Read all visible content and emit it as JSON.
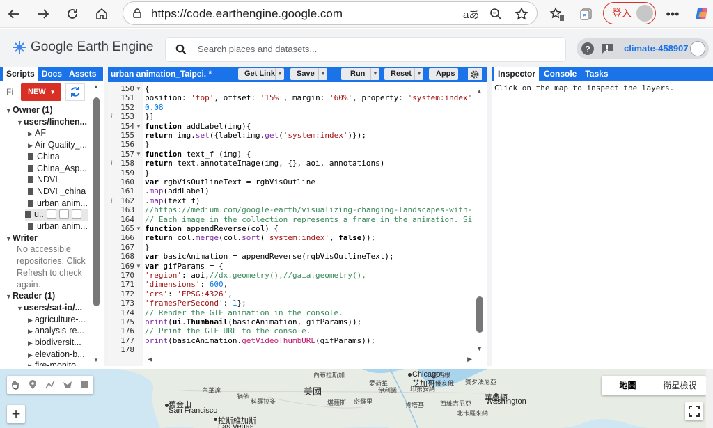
{
  "browser": {
    "url": "https://code.earthengine.google.com",
    "login_label": "登入",
    "icons": [
      "back-icon",
      "forward-icon",
      "reload-icon",
      "home-icon",
      "lock-icon",
      "read-aloud-icon",
      "zoom-icon",
      "favorite-star-icon",
      "favorites-icon",
      "collections-icon",
      "more-icon",
      "copilot-icon"
    ]
  },
  "header": {
    "app_title": "Google Earth Engine",
    "search_placeholder": "Search places and datasets...",
    "project": "climate-458907"
  },
  "left_tabs": [
    "Scripts",
    "Docs",
    "Assets"
  ],
  "scripts": {
    "filter_placeholder": "Fi",
    "new_label": "NEW",
    "tree": [
      {
        "label": "Owner (1)",
        "level": 0,
        "type": "group",
        "arrow": "down"
      },
      {
        "label": "users/linchen...",
        "level": 1,
        "type": "repo",
        "arrow": "down"
      },
      {
        "label": "AF",
        "level": 2,
        "type": "folder",
        "arrow": "right"
      },
      {
        "label": "Air Quality_...",
        "level": 2,
        "type": "folder",
        "arrow": "right"
      },
      {
        "label": "China",
        "level": 2,
        "type": "file"
      },
      {
        "label": "China_Asp...",
        "level": 2,
        "type": "file"
      },
      {
        "label": "NDVI",
        "level": 2,
        "type": "file"
      },
      {
        "label": "NDVI _china",
        "level": 2,
        "type": "file"
      },
      {
        "label": "urban anim...",
        "level": 2,
        "type": "file"
      },
      {
        "label": "u..",
        "level": 2,
        "type": "file-selected"
      },
      {
        "label": "urban anim...",
        "level": 2,
        "type": "file"
      },
      {
        "label": "Writer",
        "level": 0,
        "type": "group",
        "arrow": "down"
      },
      {
        "label": "No accessible",
        "level": 1,
        "type": "note"
      },
      {
        "label": "repositories. Click",
        "level": 1,
        "type": "note"
      },
      {
        "label": "Refresh to check",
        "level": 1,
        "type": "note"
      },
      {
        "label": "again.",
        "level": 1,
        "type": "note"
      },
      {
        "label": "Reader (1)",
        "level": 0,
        "type": "group",
        "arrow": "down"
      },
      {
        "label": "users/sat-io/...",
        "level": 1,
        "type": "repo",
        "arrow": "down"
      },
      {
        "label": "agriculture-...",
        "level": 2,
        "type": "folder",
        "arrow": "right"
      },
      {
        "label": "analysis-re...",
        "level": 2,
        "type": "folder",
        "arrow": "right"
      },
      {
        "label": "biodiversit...",
        "level": 2,
        "type": "folder",
        "arrow": "right"
      },
      {
        "label": "elevation-b...",
        "level": 2,
        "type": "folder",
        "arrow": "right"
      },
      {
        "label": "fire-monito...",
        "level": 2,
        "type": "folder",
        "arrow": "right"
      }
    ]
  },
  "editor": {
    "file_name": "urban animation_Taipei. *",
    "buttons": {
      "get_link": "Get Link",
      "save": "Save",
      "run": "Run",
      "reset": "Reset",
      "apps": "Apps"
    },
    "lines": [
      {
        "n": 150,
        "fold": true,
        "info": false,
        "html": "{"
      },
      {
        "n": 151,
        "fold": false,
        "info": false,
        "html": "position: <span class='str'>'top'</span>, offset: <span class='str'>'15%'</span>, margin: <span class='str'>'60%'</span>, property: <span class='str'>'system:index'</span>, sc"
      },
      {
        "n": 152,
        "fold": false,
        "info": false,
        "html": "<span class='num'>0.08</span>"
      },
      {
        "n": 153,
        "fold": false,
        "info": true,
        "html": "}]"
      },
      {
        "n": 154,
        "fold": true,
        "info": false,
        "html": "<span class='kw'>function</span> addLabel(img){"
      },
      {
        "n": 155,
        "fold": false,
        "info": false,
        "html": "<span class='kw'>return</span> img.<span class='mth'>set</span>({label:img.<span class='mth'>get</span>(<span class='str'>'system:index'</span>)});"
      },
      {
        "n": 156,
        "fold": false,
        "info": false,
        "html": "}"
      },
      {
        "n": 157,
        "fold": true,
        "info": false,
        "html": "<span class='kw'>function</span> text_f (img) {"
      },
      {
        "n": 158,
        "fold": false,
        "info": true,
        "html": "<span class='kw'>return</span> text.annotateImage(img, {}, aoi, annotations)"
      },
      {
        "n": 159,
        "fold": false,
        "info": false,
        "html": "}"
      },
      {
        "n": 160,
        "fold": false,
        "info": false,
        "html": "<span class='kw'>var</span> rgbVisOutlineText = rgbVisOutline"
      },
      {
        "n": 161,
        "fold": false,
        "info": false,
        "html": ".<span class='mth'>map</span>(addLabel)"
      },
      {
        "n": 162,
        "fold": false,
        "info": true,
        "html": ".<span class='mth'>map</span>(text_f)"
      },
      {
        "n": 163,
        "fold": false,
        "info": false,
        "html": "<span class='cm'>//https://medium.com/google-earth/visualizing-changing-landscapes-with-goog</span>"
      },
      {
        "n": 164,
        "fold": false,
        "info": false,
        "html": "<span class='cm'>// Each image in the collection represents a frame in the animation. Since</span>"
      },
      {
        "n": 165,
        "fold": true,
        "info": false,
        "html": "<span class='kw'>function</span> appendReverse(col) {"
      },
      {
        "n": 166,
        "fold": false,
        "info": false,
        "html": "<span class='kw'>return</span> col.<span class='mth'>merge</span>(col.<span class='mth'>sort</span>(<span class='str'>'system:index'</span>, <span class='kw'>false</span>));"
      },
      {
        "n": 167,
        "fold": false,
        "info": false,
        "html": "}"
      },
      {
        "n": 168,
        "fold": false,
        "info": false,
        "html": "<span class='kw'>var</span> basicAnimation = appendReverse(rgbVisOutlineText);"
      },
      {
        "n": 169,
        "fold": true,
        "info": false,
        "html": "<span class='kw'>var</span> gifParams = {"
      },
      {
        "n": 170,
        "fold": false,
        "info": false,
        "html": "<span class='str'>'region'</span>: aoi,<span class='cm'>//dx.geometry(),//gaia.geometry(),</span>"
      },
      {
        "n": 171,
        "fold": false,
        "info": false,
        "html": "<span class='str'>'dimensions'</span>: <span class='num'>600</span>,"
      },
      {
        "n": 172,
        "fold": false,
        "info": false,
        "html": "<span class='str'>'crs'</span>: <span class='str'>'EPSG:4326'</span>,"
      },
      {
        "n": 173,
        "fold": false,
        "info": false,
        "html": "<span class='str'>'framesPerSecond'</span>: <span class='num'>1</span>};"
      },
      {
        "n": 174,
        "fold": false,
        "info": false,
        "html": "<span class='cm'>// Render the GIF animation in the console.</span>"
      },
      {
        "n": 175,
        "fold": false,
        "info": false,
        "html": "<span class='mth'>print</span>(<span class='kw'>ui</span>.<span class='kw'>Thumbnail</span>(basicAnimation, gifParams));"
      },
      {
        "n": 176,
        "fold": false,
        "info": false,
        "html": "<span class='cm'>// Print the GIF URL to the console.</span>"
      },
      {
        "n": 177,
        "fold": false,
        "info": false,
        "html": "<span class='mth'>print</span>(basicAnimation.<span class='ee'>getVideoThumbURL</span>(gifParams));"
      },
      {
        "n": 178,
        "fold": false,
        "info": false,
        "html": ""
      }
    ]
  },
  "right_tabs": [
    "Inspector",
    "Console",
    "Tasks"
  ],
  "inspector": {
    "message": "Click on the map to inspect the layers."
  },
  "map": {
    "type_buttons": [
      "地圖",
      "衛星檢視"
    ],
    "labels": [
      {
        "t": "美國",
        "cls": "big"
      },
      {
        "t": "舊金山",
        "cls": "city"
      },
      {
        "t": "San Francisco",
        "cls": "city"
      },
      {
        "t": "拉斯維加斯",
        "cls": "city"
      },
      {
        "t": "Las Vegas",
        "cls": "city"
      },
      {
        "t": "Chicago",
        "cls": "city"
      },
      {
        "t": "芝加哥",
        "cls": "city"
      },
      {
        "t": "華盛頓",
        "cls": "city"
      },
      {
        "t": "Washington",
        "cls": "city"
      },
      {
        "t": "內華達",
        "cls": ""
      },
      {
        "t": "猶他",
        "cls": ""
      },
      {
        "t": "科羅拉多",
        "cls": ""
      },
      {
        "t": "堪薩斯",
        "cls": ""
      },
      {
        "t": "密蘇里",
        "cls": ""
      },
      {
        "t": "內布拉斯加",
        "cls": ""
      },
      {
        "t": "愛荷華",
        "cls": ""
      },
      {
        "t": "伊利諾",
        "cls": ""
      },
      {
        "t": "印第安納",
        "cls": ""
      },
      {
        "t": "俄亥俄",
        "cls": ""
      },
      {
        "t": "賓夕法尼亞",
        "cls": ""
      },
      {
        "t": "西維吉尼亞",
        "cls": ""
      },
      {
        "t": "肯塔基",
        "cls": ""
      },
      {
        "t": "北卡羅來納",
        "cls": ""
      },
      {
        "t": "密西根",
        "cls": ""
      }
    ]
  }
}
